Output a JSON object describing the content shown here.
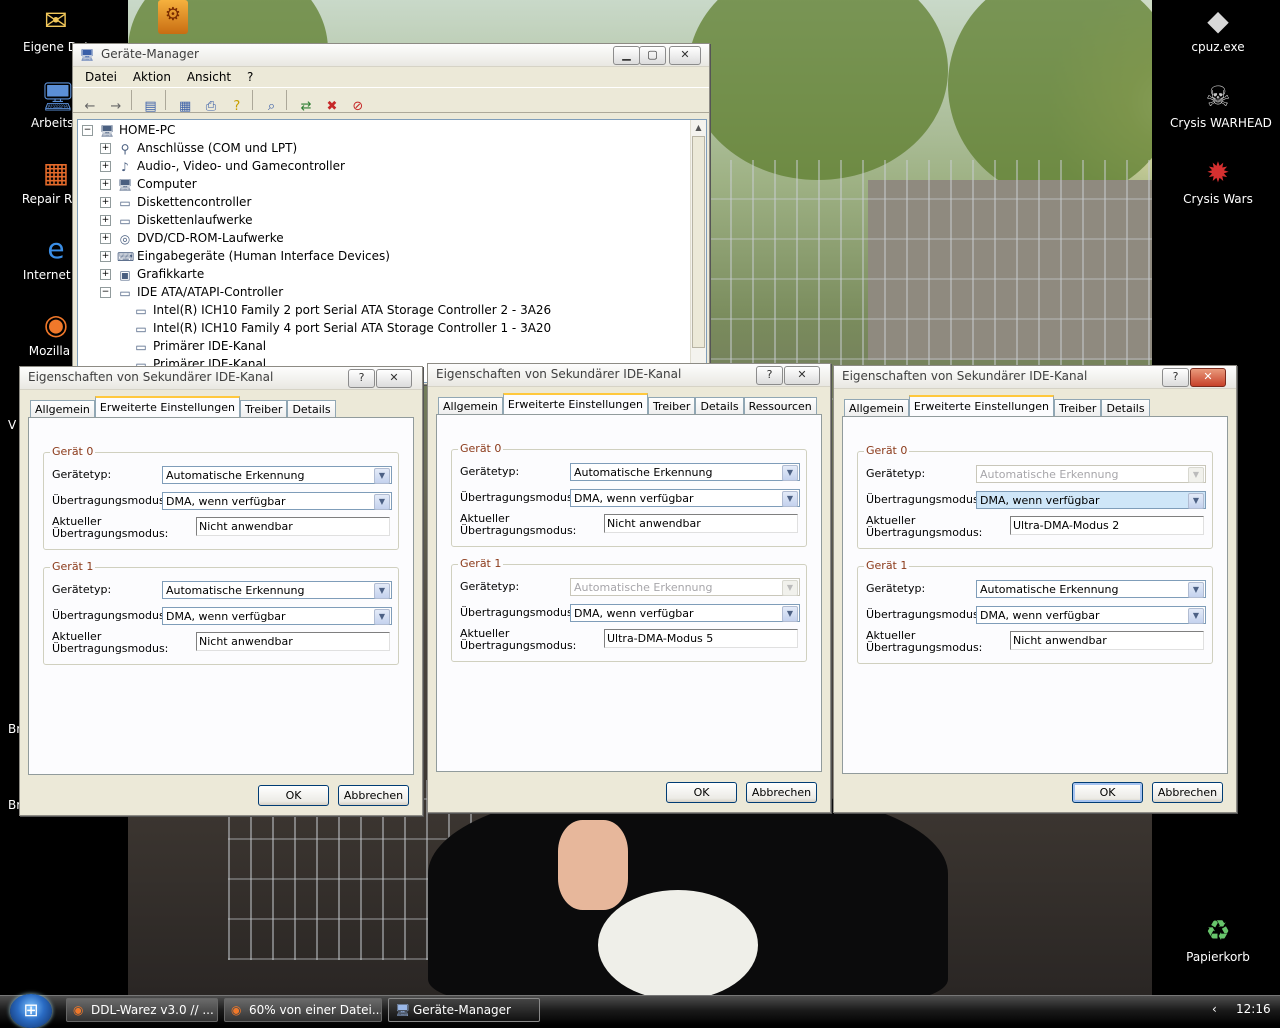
{
  "desktop": {
    "left_icons": [
      {
        "label": "Eigene Dat",
        "icon": "folder-envelope-icon"
      },
      {
        "label": "Arbeitsp",
        "icon": "computer-icon"
      },
      {
        "label": "Repair Regi",
        "icon": "registry-tool-icon"
      },
      {
        "label": "Internet Ex",
        "icon": "internet-explorer-icon"
      },
      {
        "label": "Mozilla Fi",
        "icon": "firefox-icon"
      }
    ],
    "left_clipped_labels": [
      "V",
      "Br",
      "Br"
    ],
    "right_icons": [
      {
        "label": "cpuz.exe",
        "icon": "cpuz-icon"
      },
      {
        "label": "Crysis WARHEAD",
        "icon": "crysis-warhead-icon"
      },
      {
        "label": "Crysis Wars",
        "icon": "crysis-wars-icon"
      },
      {
        "label": "Papierkorb",
        "icon": "recycle-bin-icon"
      }
    ]
  },
  "device_manager": {
    "title": "Geräte-Manager",
    "menu": [
      "Datei",
      "Aktion",
      "Ansicht",
      "?"
    ],
    "root": "HOME-PC",
    "tree": [
      {
        "label": "Anschlüsse (COM und LPT)",
        "expander": "+",
        "level": 1
      },
      {
        "label": "Audio-, Video- und Gamecontroller",
        "expander": "+",
        "level": 1
      },
      {
        "label": "Computer",
        "expander": "+",
        "level": 1
      },
      {
        "label": "Diskettencontroller",
        "expander": "+",
        "level": 1
      },
      {
        "label": "Diskettenlaufwerke",
        "expander": "+",
        "level": 1
      },
      {
        "label": "DVD/CD-ROM-Laufwerke",
        "expander": "+",
        "level": 1
      },
      {
        "label": "Eingabegeräte (Human Interface Devices)",
        "expander": "+",
        "level": 1
      },
      {
        "label": "Grafikkarte",
        "expander": "+",
        "level": 1
      },
      {
        "label": "IDE ATA/ATAPI-Controller",
        "expander": "-",
        "level": 1
      },
      {
        "label": "Intel(R) ICH10 Family 2 port Serial ATA Storage Controller 2 - 3A26",
        "expander": "",
        "level": 2
      },
      {
        "label": "Intel(R) ICH10 Family 4 port Serial ATA Storage Controller 1 - 3A20",
        "expander": "",
        "level": 2
      },
      {
        "label": "Primärer IDE-Kanal",
        "expander": "",
        "level": 2
      },
      {
        "label": "Primärer IDE-Kanal",
        "expander": "",
        "level": 2
      }
    ]
  },
  "dialogs": [
    {
      "title": "Eigenschaften von Sekundärer IDE-Kanal",
      "tabs": [
        "Allgemein",
        "Erweiterte Einstellungen",
        "Treiber",
        "Details"
      ],
      "active_tab": 1,
      "devices": [
        {
          "group": "Gerät 0",
          "type_label": "Gerätetyp:",
          "type_value": "Automatische Erkennung",
          "type_disabled": false,
          "mode_label": "Übertragungsmodus:",
          "mode_value": "DMA, wenn verfügbar",
          "mode_highlight": false,
          "current_label_1": "Aktueller",
          "current_label_2": "Übertragungsmodus:",
          "current_value": "Nicht anwendbar"
        },
        {
          "group": "Gerät 1",
          "type_label": "Gerätetyp:",
          "type_value": "Automatische Erkennung",
          "type_disabled": false,
          "mode_label": "Übertragungsmodus:",
          "mode_value": "DMA, wenn verfügbar",
          "mode_highlight": false,
          "current_label_1": "Aktueller",
          "current_label_2": "Übertragungsmodus:",
          "current_value": "Nicht anwendbar"
        }
      ],
      "ok_label": "OK",
      "cancel_label": "Abbrechen"
    },
    {
      "title": "Eigenschaften von Sekundärer IDE-Kanal",
      "tabs": [
        "Allgemein",
        "Erweiterte Einstellungen",
        "Treiber",
        "Details",
        "Ressourcen"
      ],
      "active_tab": 1,
      "devices": [
        {
          "group": "Gerät 0",
          "type_label": "Gerätetyp:",
          "type_value": "Automatische Erkennung",
          "type_disabled": false,
          "mode_label": "Übertragungsmodus:",
          "mode_value": "DMA, wenn verfügbar",
          "mode_highlight": false,
          "current_label_1": "Aktueller",
          "current_label_2": "Übertragungsmodus:",
          "current_value": "Nicht anwendbar"
        },
        {
          "group": "Gerät 1",
          "type_label": "Gerätetyp:",
          "type_value": "Automatische Erkennung",
          "type_disabled": true,
          "mode_label": "Übertragungsmodus:",
          "mode_value": "DMA, wenn verfügbar",
          "mode_highlight": false,
          "current_label_1": "Aktueller",
          "current_label_2": "Übertragungsmodus:",
          "current_value": "Ultra-DMA-Modus 5"
        }
      ],
      "ok_label": "OK",
      "cancel_label": "Abbrechen"
    },
    {
      "title": "Eigenschaften von Sekundärer IDE-Kanal",
      "tabs": [
        "Allgemein",
        "Erweiterte Einstellungen",
        "Treiber",
        "Details"
      ],
      "active_tab": 1,
      "devices": [
        {
          "group": "Gerät 0",
          "type_label": "Gerätetyp:",
          "type_value": "Automatische Erkennung",
          "type_disabled": true,
          "mode_label": "Übertragungsmodus:",
          "mode_value": "DMA, wenn verfügbar",
          "mode_highlight": true,
          "current_label_1": "Aktueller",
          "current_label_2": "Übertragungsmodus:",
          "current_value": "Ultra-DMA-Modus 2"
        },
        {
          "group": "Gerät 1",
          "type_label": "Gerätetyp:",
          "type_value": "Automatische Erkennung",
          "type_disabled": false,
          "mode_label": "Übertragungsmodus:",
          "mode_value": "DMA, wenn verfügbar",
          "mode_highlight": false,
          "current_label_1": "Aktueller",
          "current_label_2": "Übertragungsmodus:",
          "current_value": "Nicht anwendbar"
        }
      ],
      "ok_label": "OK",
      "cancel_label": "Abbrechen"
    }
  ],
  "taskbar": {
    "tasks": [
      {
        "label": "DDL-Warez v3.0 // ...",
        "icon": "firefox-icon"
      },
      {
        "label": "60% von einer Datei...",
        "icon": "firefox-icon"
      },
      {
        "label": "Geräte-Manager",
        "icon": "device-manager-icon"
      }
    ],
    "tray_arrow": "‹",
    "clock": "12:16"
  }
}
